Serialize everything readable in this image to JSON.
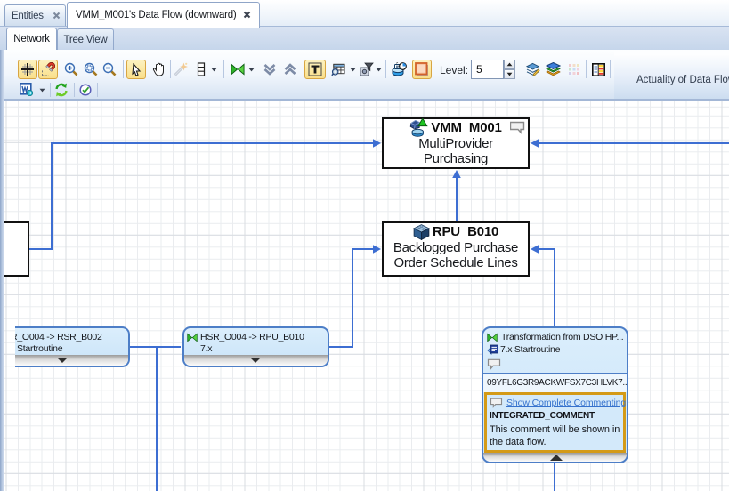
{
  "editor_tabs": {
    "entities": "Entities",
    "active": "VMM_M001's Data Flow (downward)"
  },
  "view_tabs": {
    "network": "Network",
    "tree_view": "Tree View"
  },
  "toolbar": {
    "level_label": "Level:",
    "level_value": "5",
    "panel_title": "Actuality of Data Flow",
    "row1_icons": [
      "grid-snap-icon",
      "magnet-snap-icon",
      "zoom-in-icon",
      "zoom-fit-icon",
      "zoom-out-icon",
      "select-cursor-icon",
      "pan-hand-icon",
      "magic-wand-icon",
      "layout-icon",
      "transformation-icon",
      "collapse-all-icon",
      "expand-all-icon",
      "text-icon",
      "table-search-icon",
      "filter-icon",
      "print-schedule-icon",
      "background-color-icon",
      "layers-edit-icon",
      "layers-icon",
      "color-grid-icon",
      "legend-icon"
    ],
    "row2_icons": [
      "word-export-icon",
      "refresh-icon",
      "clock-check-icon"
    ]
  },
  "colors": {
    "connector_blue": "#3d6ed2",
    "node_border_black": "#111111",
    "transformation_border": "#4d7ec7",
    "transformation_fill": "#d3e9fa",
    "comment_highlight_border": "#d49a17",
    "link_blue": "#3672cd",
    "selected_button_fill": "#f9df8a"
  },
  "diagram": {
    "vmm": {
      "id": "VMM_M001",
      "line1": "MultiProvider",
      "line2": "Purchasing"
    },
    "rpu": {
      "id": "RPU_B010",
      "line1": "Backlogged Purchase",
      "line2": "Order Schedule Lines"
    },
    "tr_left": {
      "line1": "R_O004 -> RSR_B002",
      "line2": "Startroutine"
    },
    "tr_mid": {
      "line1": "HSR_O004 -> RPU_B010",
      "line2": "7.x"
    },
    "tr_right": {
      "line1": "Transformation from DSO HP...",
      "line2": "7.x Startroutine",
      "hash": "09YFL6G3R9ACKWFSX7C3HLVK7...",
      "comment_link": "Show Complete Commenting",
      "comment_title": "INTEGRATED_COMMENT",
      "comment_body1": "This comment will be shown in",
      "comment_body2": "the data flow."
    }
  }
}
